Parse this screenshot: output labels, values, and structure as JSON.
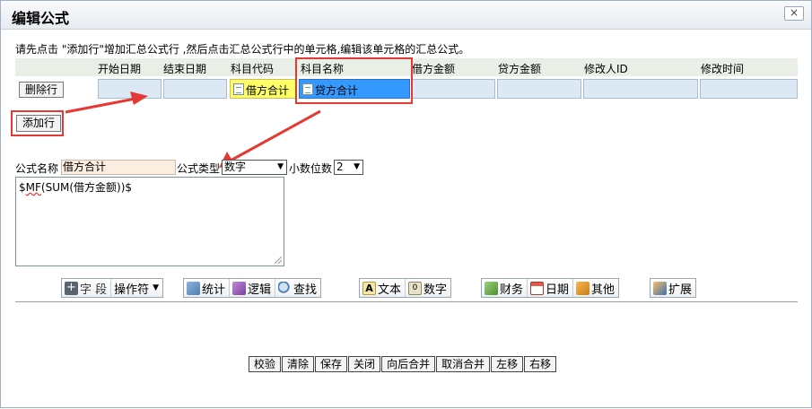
{
  "window": {
    "title": "编辑公式",
    "close_label": "×"
  },
  "instruction": "请先点击 \"添加行\"增加汇总公式行 ,然后点击汇总公式行中的单元格,编辑该单元格的汇总公式。",
  "grid": {
    "columns": [
      "开始日期",
      "结束日期",
      "科目代码",
      "科目名称",
      "借方金额",
      "贷方金额",
      "修改人ID",
      "修改时间"
    ],
    "delete_row_label": "删除行",
    "row": {
      "start_date": "",
      "end_date": "",
      "subject_code": "借方合计",
      "subject_name": "贷方合计",
      "debit_amount": "",
      "credit_amount": "",
      "modifier_id": "",
      "modified_time": ""
    }
  },
  "add_row_label": "添加行",
  "formula": {
    "name_label": "公式名称",
    "name_value": "借方合计",
    "type_label": "公式类型",
    "type_value": "数字",
    "decimals_label": "小数位数",
    "decimals_value": "2",
    "text_prefix": "$",
    "text_mf": "MF",
    "text_rest": "(SUM(借方金额))$"
  },
  "toolbar": {
    "field_label": "字 段",
    "operator_label": "操作符",
    "stats_label": "统计",
    "logic_label": "逻辑",
    "find_label": "查找",
    "text_label": "文本",
    "number_label": "数字",
    "finance_label": "财务",
    "date_label": "日期",
    "other_label": "其他",
    "extend_label": "扩展"
  },
  "buttons": {
    "validate": "校验",
    "clear": "清除",
    "save": "保存",
    "close": "关闭",
    "merge_forward": "向后合并",
    "unmerge": "取消合并",
    "move_left": "左移",
    "move_right": "右移"
  },
  "colors": {
    "accent_red": "#e53935",
    "selected_cell": "#3399ff",
    "yellow_cell": "#ffff66",
    "cell_bg": "#dce9f4",
    "header_bg": "#e9efe6"
  },
  "icons": [
    "close-icon",
    "cell-edit-icon",
    "plus-icon",
    "stats-icon",
    "logic-icon",
    "find-icon",
    "text-icon",
    "number-icon",
    "finance-icon",
    "calendar-icon",
    "other-icon",
    "extend-icon",
    "dropdown-caret-icon"
  ]
}
